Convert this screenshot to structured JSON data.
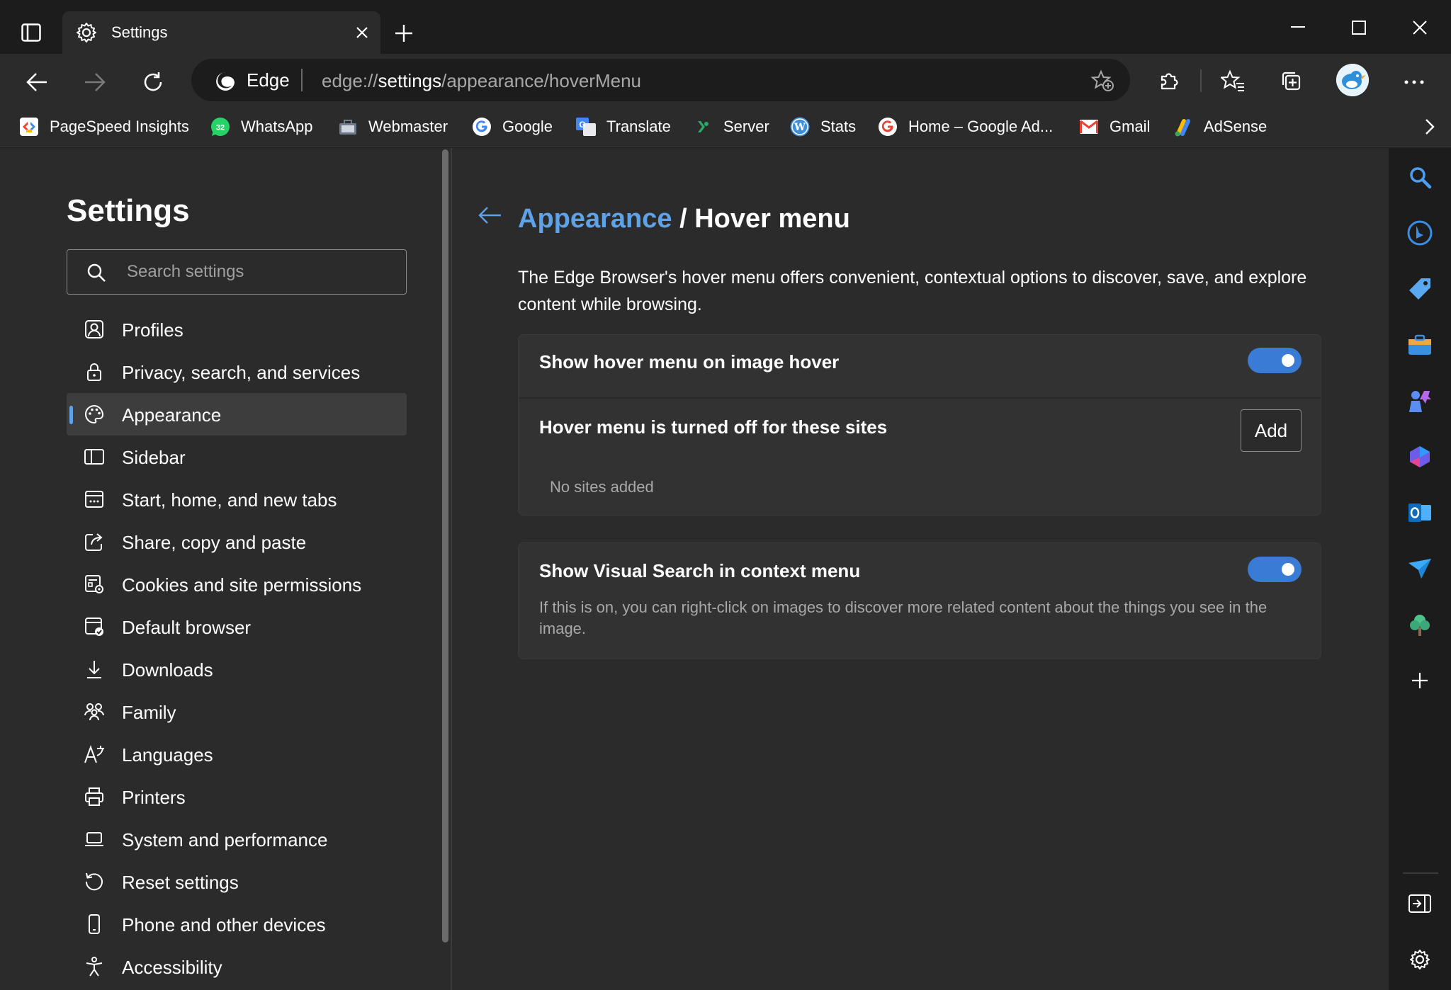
{
  "window": {
    "tab_title": "Settings",
    "icons": [
      "tab-actions-icon",
      "gear-icon",
      "close-icon",
      "new-tab-icon",
      "minimize-icon",
      "maximize-icon",
      "window-close-icon"
    ]
  },
  "toolbar": {
    "browser_label": "Edge",
    "url_prefix": "edge://",
    "url_highlight": "settings",
    "url_suffix": "/appearance/hoverMenu"
  },
  "favorites": [
    {
      "label": "PageSpeed Insights",
      "icon": "pagespeed-icon"
    },
    {
      "label": "WhatsApp",
      "icon": "whatsapp-icon",
      "badge": "32"
    },
    {
      "label": "Webmaster",
      "icon": "webmaster-icon"
    },
    {
      "label": "Google",
      "icon": "google-icon"
    },
    {
      "label": "Translate",
      "icon": "translate-icon"
    },
    {
      "label": "Server",
      "icon": "server-icon"
    },
    {
      "label": "Stats",
      "icon": "wordpress-icon"
    },
    {
      "label": "Home – Google Ad...",
      "icon": "google-icon"
    },
    {
      "label": "Gmail",
      "icon": "gmail-icon"
    },
    {
      "label": "AdSense",
      "icon": "adsense-icon"
    }
  ],
  "nav": {
    "title": "Settings",
    "search_placeholder": "Search settings",
    "items": [
      {
        "label": "Profiles",
        "icon": "profile-icon"
      },
      {
        "label": "Privacy, search, and services",
        "icon": "lock-icon"
      },
      {
        "label": "Appearance",
        "icon": "palette-icon",
        "active": true
      },
      {
        "label": "Sidebar",
        "icon": "sidebar-icon"
      },
      {
        "label": "Start, home, and new tabs",
        "icon": "home-tabs-icon"
      },
      {
        "label": "Share, copy and paste",
        "icon": "share-icon"
      },
      {
        "label": "Cookies and site permissions",
        "icon": "cookies-icon"
      },
      {
        "label": "Default browser",
        "icon": "default-browser-icon"
      },
      {
        "label": "Downloads",
        "icon": "download-icon"
      },
      {
        "label": "Family",
        "icon": "family-icon"
      },
      {
        "label": "Languages",
        "icon": "languages-icon"
      },
      {
        "label": "Printers",
        "icon": "printer-icon"
      },
      {
        "label": "System and performance",
        "icon": "laptop-icon"
      },
      {
        "label": "Reset settings",
        "icon": "reset-icon"
      },
      {
        "label": "Phone and other devices",
        "icon": "phone-icon"
      },
      {
        "label": "Accessibility",
        "icon": "accessibility-icon"
      }
    ]
  },
  "main": {
    "breadcrumb_link": "Appearance",
    "breadcrumb_sep": "/",
    "breadcrumb_current": "Hover menu",
    "description": "The Edge Browser's hover menu offers convenient, contextual options to discover, save, and explore content while browsing.",
    "hover_toggle_label": "Show hover menu on image hover",
    "hover_toggle_on": true,
    "sites_title": "Hover menu is turned off for these sites",
    "add_label": "Add",
    "no_sites": "No sites added",
    "visual_search_label": "Show Visual Search in context menu",
    "visual_search_on": true,
    "visual_search_desc": "If this is on, you can right-click on images to discover more related content about the things you see in the image."
  },
  "colors": {
    "accent": "#5ea3e8",
    "toggle_on": "#3a7bd5",
    "background": "#2b2b2b",
    "card": "#323232"
  },
  "right_sidebar": {
    "icons": [
      "search-icon",
      "bing-chat-icon",
      "shopping-tag-icon",
      "tools-icon",
      "games-icon",
      "copilot-icon",
      "outlook-icon",
      "send-icon",
      "tree-icon",
      "add-icon",
      "hide-sidebar-icon",
      "sidebar-settings-icon"
    ]
  }
}
